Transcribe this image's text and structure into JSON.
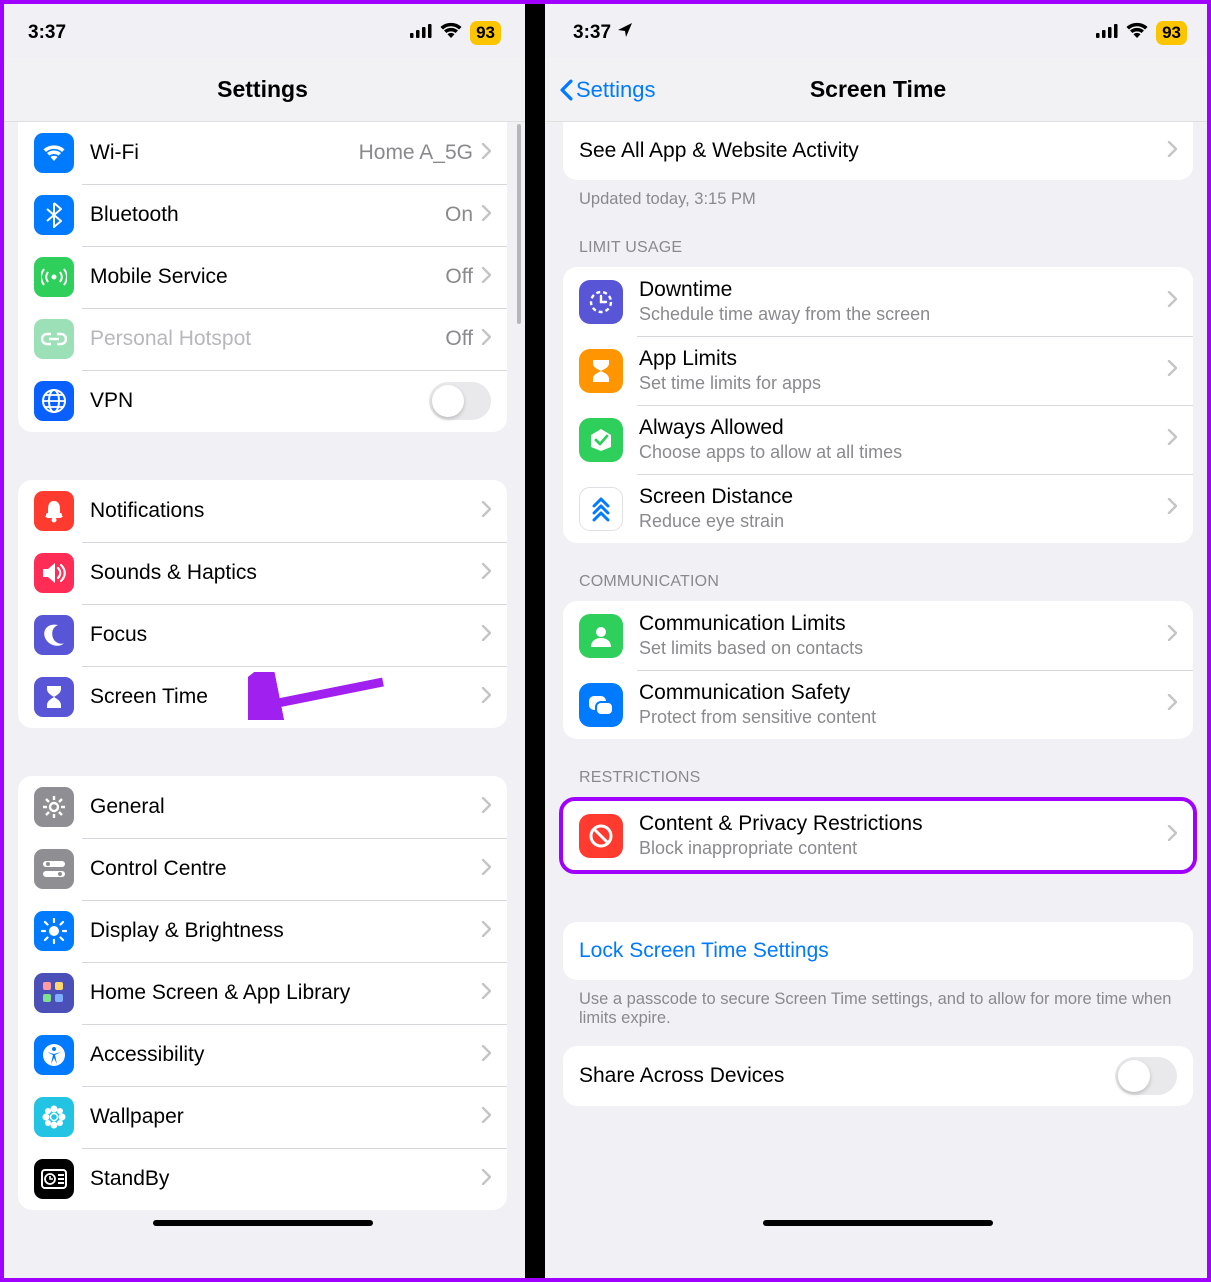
{
  "left": {
    "status": {
      "time": "3:37",
      "battery": "93"
    },
    "nav": {
      "title": "Settings"
    },
    "group1": [
      {
        "icon": "wifi",
        "color": "#007aff",
        "label": "Wi-Fi",
        "value": "Home A_5G",
        "chev": true
      },
      {
        "icon": "bt",
        "color": "#007aff",
        "label": "Bluetooth",
        "value": "On",
        "chev": true
      },
      {
        "icon": "antenna",
        "color": "#2fcf5b",
        "label": "Mobile Service",
        "value": "Off",
        "chev": true
      },
      {
        "icon": "link",
        "color": "#9be0b6",
        "label": "Personal Hotspot",
        "value": "Off",
        "chev": true,
        "disabled": true
      },
      {
        "icon": "globe",
        "color": "#0a5fff",
        "label": "VPN",
        "toggle": false
      }
    ],
    "group2": [
      {
        "icon": "bell",
        "color": "#ff3b30",
        "label": "Notifications",
        "chev": true
      },
      {
        "icon": "sound",
        "color": "#ff2c55",
        "label": "Sounds & Haptics",
        "chev": true
      },
      {
        "icon": "moon",
        "color": "#5856d6",
        "label": "Focus",
        "chev": true
      },
      {
        "icon": "hour",
        "color": "#5856d6",
        "label": "Screen Time",
        "chev": true,
        "annot_arrow": true
      }
    ],
    "group3": [
      {
        "icon": "gear",
        "color": "#8e8e93",
        "label": "General",
        "chev": true
      },
      {
        "icon": "switches",
        "color": "#8e8e93",
        "label": "Control Centre",
        "chev": true
      },
      {
        "icon": "sun",
        "color": "#007aff",
        "label": "Display & Brightness",
        "chev": true
      },
      {
        "icon": "grid",
        "color": "#4b4fb8",
        "label": "Home Screen & App Library",
        "chev": true
      },
      {
        "icon": "access",
        "color": "#007aff",
        "label": "Accessibility",
        "chev": true
      },
      {
        "icon": "flower",
        "color": "#23c4e3",
        "label": "Wallpaper",
        "chev": true
      },
      {
        "icon": "clock",
        "color": "#000000",
        "label": "StandBy",
        "chev": true
      }
    ]
  },
  "right": {
    "status": {
      "time": "3:37",
      "battery": "93"
    },
    "nav": {
      "back": "Settings",
      "title": "Screen Time"
    },
    "activity": {
      "label": "See All App & Website Activity",
      "updated": "Updated today, 3:15 PM"
    },
    "limit_header": "LIMIT USAGE",
    "limit_items": [
      {
        "icon": "downtime",
        "color": "#5856d6",
        "title": "Downtime",
        "sub": "Schedule time away from the screen"
      },
      {
        "icon": "applimit",
        "color": "#ff9500",
        "title": "App Limits",
        "sub": "Set time limits for apps"
      },
      {
        "icon": "allowed",
        "color": "#2fcf5b",
        "title": "Always Allowed",
        "sub": "Choose apps to allow at all times"
      },
      {
        "icon": "distance",
        "color": "#ffffff",
        "title": "Screen Distance",
        "sub": "Reduce eye strain",
        "white": true
      }
    ],
    "comm_header": "COMMUNICATION",
    "comm_items": [
      {
        "icon": "contact",
        "color": "#2fcf5b",
        "title": "Communication Limits",
        "sub": "Set limits based on contacts"
      },
      {
        "icon": "safety",
        "color": "#007aff",
        "title": "Communication Safety",
        "sub": "Protect from sensitive content"
      }
    ],
    "restr_header": "RESTRICTIONS",
    "restr_items": [
      {
        "icon": "nosign",
        "color": "#ff3b30",
        "title": "Content & Privacy Restrictions",
        "sub": "Block inappropriate content"
      }
    ],
    "lock_link": "Lock Screen Time Settings",
    "lock_footer": "Use a passcode to secure Screen Time settings, and to allow for more time when limits expire.",
    "share": {
      "label": "Share Across Devices"
    }
  }
}
